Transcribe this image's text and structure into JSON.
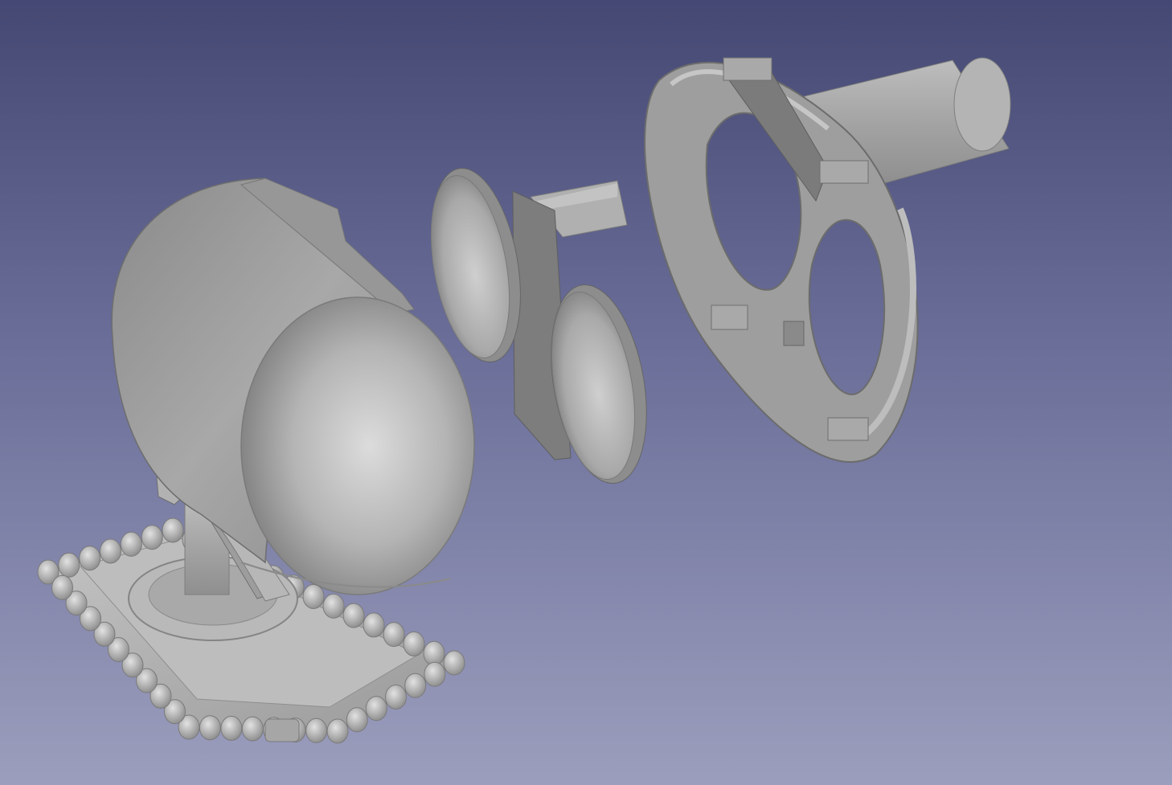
{
  "viewport": {
    "background_top": "#444873",
    "background_bottom": "#9c9ebd",
    "part_color": "#a4a4a4"
  },
  "scene": {
    "parts": [
      {
        "name": "lamp-housing-with-base"
      },
      {
        "name": "lens-holder-with-lenses"
      },
      {
        "name": "front-bezel-ring"
      }
    ]
  }
}
